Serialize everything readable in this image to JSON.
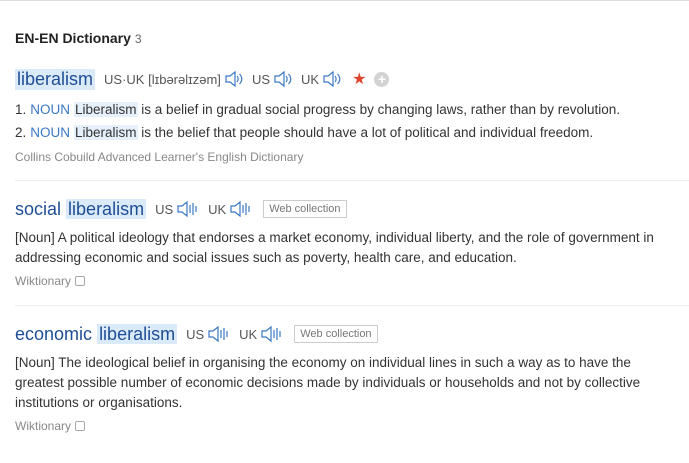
{
  "header": {
    "title": "EN-EN Dictionary",
    "count": "3"
  },
  "entry1": {
    "word": "liberalism",
    "phonetic": "US·UK [lɪbərəlɪzəm]",
    "us_label": "US",
    "uk_label": "UK",
    "senses": [
      {
        "num": "1.",
        "pos": "NOUN",
        "word": "Liberalism",
        "rest": " is a belief in gradual social progress by changing laws, rather than by revolution."
      },
      {
        "num": "2.",
        "pos": "NOUN",
        "word": "Liberalism",
        "rest": " is the belief that people should have a lot of political and individual freedom."
      }
    ],
    "source": "Collins Cobuild Advanced Learner's English Dictionary"
  },
  "entry2": {
    "word_a": "social",
    "word_b": "liberalism",
    "us_label": "US",
    "uk_label": "UK",
    "tag": "Web collection",
    "definition": "[Noun] A political ideology that endorses a market economy, individual liberty, and the role of government in addressing economic and social issues such as poverty, health care, and education.",
    "source": "Wiktionary"
  },
  "entry3": {
    "word_a": "economic",
    "word_b": "liberalism",
    "us_label": "US",
    "uk_label": "UK",
    "tag": "Web collection",
    "definition": "[Noun] The ideological belief in organising the economy on individual lines in such a way as to have the greatest possible number of economic decisions made by individuals or households and not by collective institutions or organisations.",
    "source": "Wiktionary"
  },
  "colors": {
    "headword": "#1f4e96",
    "pos": "#3a78c3",
    "star": "#e0432e",
    "highlight": "#dbeaf8"
  },
  "icons": {
    "speaker": "speaker-icon",
    "favorite": "star-icon",
    "add": "plus-icon",
    "copy": "copy-icon"
  }
}
